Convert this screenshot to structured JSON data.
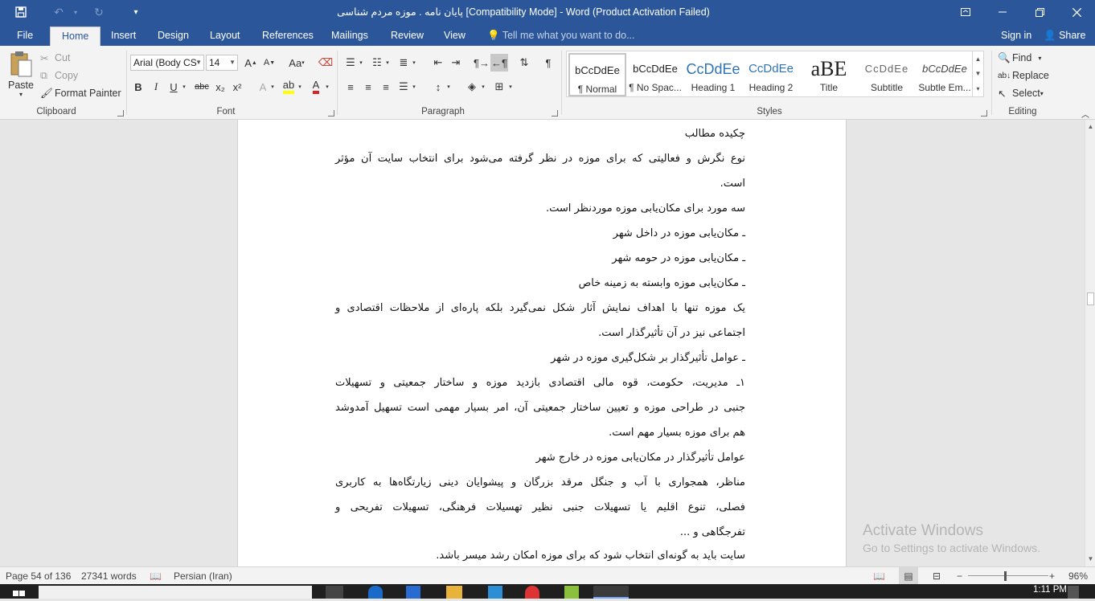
{
  "window": {
    "title": "پایان نامه . موزه  مردم شناسی [Compatibility Mode] - Word (Product Activation Failed)"
  },
  "qat": {
    "save_icon": "save-icon",
    "undo_icon": "undo-icon",
    "redo_icon": "redo-icon",
    "customize_icon": "customize-qat-icon"
  },
  "tabs": [
    {
      "label": "File"
    },
    {
      "label": "Home"
    },
    {
      "label": "Insert"
    },
    {
      "label": "Design"
    },
    {
      "label": "Layout"
    },
    {
      "label": "References"
    },
    {
      "label": "Mailings"
    },
    {
      "label": "Review"
    },
    {
      "label": "View"
    }
  ],
  "tellme": {
    "placeholder": "Tell me what you want to do..."
  },
  "account": {
    "signin": "Sign in",
    "share": "Share"
  },
  "clipboard": {
    "paste": "Paste",
    "cut": "Cut",
    "copy": "Copy",
    "format_painter": "Format Painter",
    "label": "Clipboard"
  },
  "font": {
    "name": "Arial (Body CS",
    "size": "14",
    "label": "Font",
    "bold": "B",
    "italic": "I",
    "underline": "U",
    "strike": "abc",
    "sub": "x₂",
    "sup": "x²",
    "aa": "Aa"
  },
  "paragraph": {
    "label": "Paragraph"
  },
  "styles": {
    "label": "Styles",
    "items": [
      {
        "preview": "bCcDdEe",
        "name": "¶ Normal"
      },
      {
        "preview": "bCcDdEe",
        "name": "¶ No Spac..."
      },
      {
        "preview": "CcDdEe",
        "name": "Heading 1"
      },
      {
        "preview": "CcDdEe",
        "name": "Heading 2"
      },
      {
        "preview": "aBE",
        "name": "Title"
      },
      {
        "preview": "CcDdEe",
        "name": "Subtitle"
      },
      {
        "preview": "bCcDdEe",
        "name": "Subtle Em..."
      }
    ]
  },
  "editing": {
    "label": "Editing",
    "find": "Find",
    "replace": "Replace",
    "select": "Select"
  },
  "document": {
    "lines": [
      "چکیده مطالب",
      "نوع نگرش و فعالیتی که برای موزه در نظر گرفته می‌شود برای انتخاب سایت آن مؤثر",
      "است.",
      "سه مورد برای مکان‌یابی موزه موردنظر است.",
      "ـ مکان‌یابی موزه در داخل شهر",
      "ـ مکان‌یابی موزه در حومه شهر",
      "ـ مکان‌یابی موزه وابسته به زمینه خاص",
      "یک موزه تنها با اهداف نمایش آثار شکل نمی‌گیرد بلکه پاره‌ای از ملاحظات اقتصادی و",
      "اجتماعی نیز در آن تأثیرگذار است.",
      "ـ عوامل تأثیرگذار بر شکل‌گیری موزه در شهر",
      "۱ـ مدیریت، حکومت، قوه مالی اقتصادی بازدید موزه و ساختار جمعیتی و تسهیلات",
      "جنبی در طراحی موزه و تعیین ساختار جمعیتی آن، امر بسیار مهمی است تسهیل آمدوشد",
      "هم برای موزه بسیار مهم است.",
      "عوامل تأثیرگذار در مکان‌یابی موزه در خارج شهر",
      "مناظر، همجواری با آب و جنگل مرقد بزرگان و پیشوایان دینی زیارتگاه‌ها به کاربری",
      "فصلی، تنوع اقلیم یا تسهیلات جنبی نظیر تهسیلات فرهنگی، تسهیلات تفریحی و",
      "تفرجگاهی و ...",
      "سایت باید به گونه‌ای انتخاب شود که برای موزه امکان رشد میسر باشد."
    ]
  },
  "watermark": {
    "line1": "Activate Windows",
    "line2": "Go to Settings to activate Windows."
  },
  "status": {
    "page": "Page 54 of 136",
    "words": "27341 words",
    "language": "Persian (Iran)",
    "zoom": "96%"
  },
  "taskbar": {
    "time": "1:11 PM"
  }
}
